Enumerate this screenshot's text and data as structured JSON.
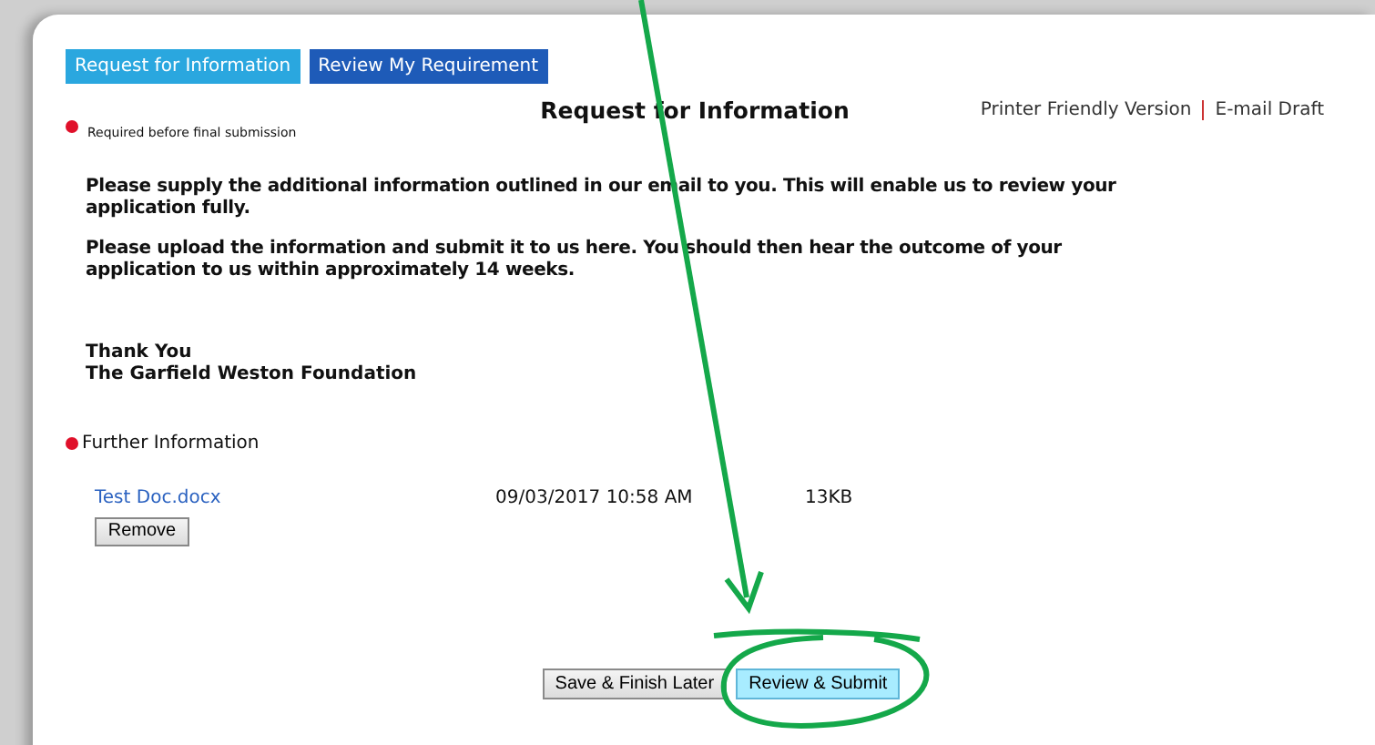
{
  "tabs": [
    {
      "label": "Request for Information",
      "selected": true
    },
    {
      "label": "Review My Requirement",
      "selected": false
    }
  ],
  "page_title": "Request for Information",
  "header_links": [
    "Printer Friendly Version",
    "E-mail Draft"
  ],
  "required_note": "Required before final submission",
  "paragraphs": [
    "Please supply the additional information outlined in our email to you. This will enable us to review your application fully.",
    "Please upload the information and submit it to us here. You should then hear the outcome of your application to us within approximately 14 weeks."
  ],
  "signature": [
    "Thank You",
    "The Garfield Weston Foundation"
  ],
  "section": {
    "label": "Further Information",
    "required": true
  },
  "files": [
    {
      "name": "Test Doc.docx",
      "date": "09/03/2017 10:58 AM",
      "size": "13KB",
      "action": "Remove"
    }
  ],
  "buttons": [
    {
      "label": "Save & Finish Later",
      "kind": "secondary"
    },
    {
      "label": "Review & Submit",
      "kind": "primary"
    }
  ]
}
